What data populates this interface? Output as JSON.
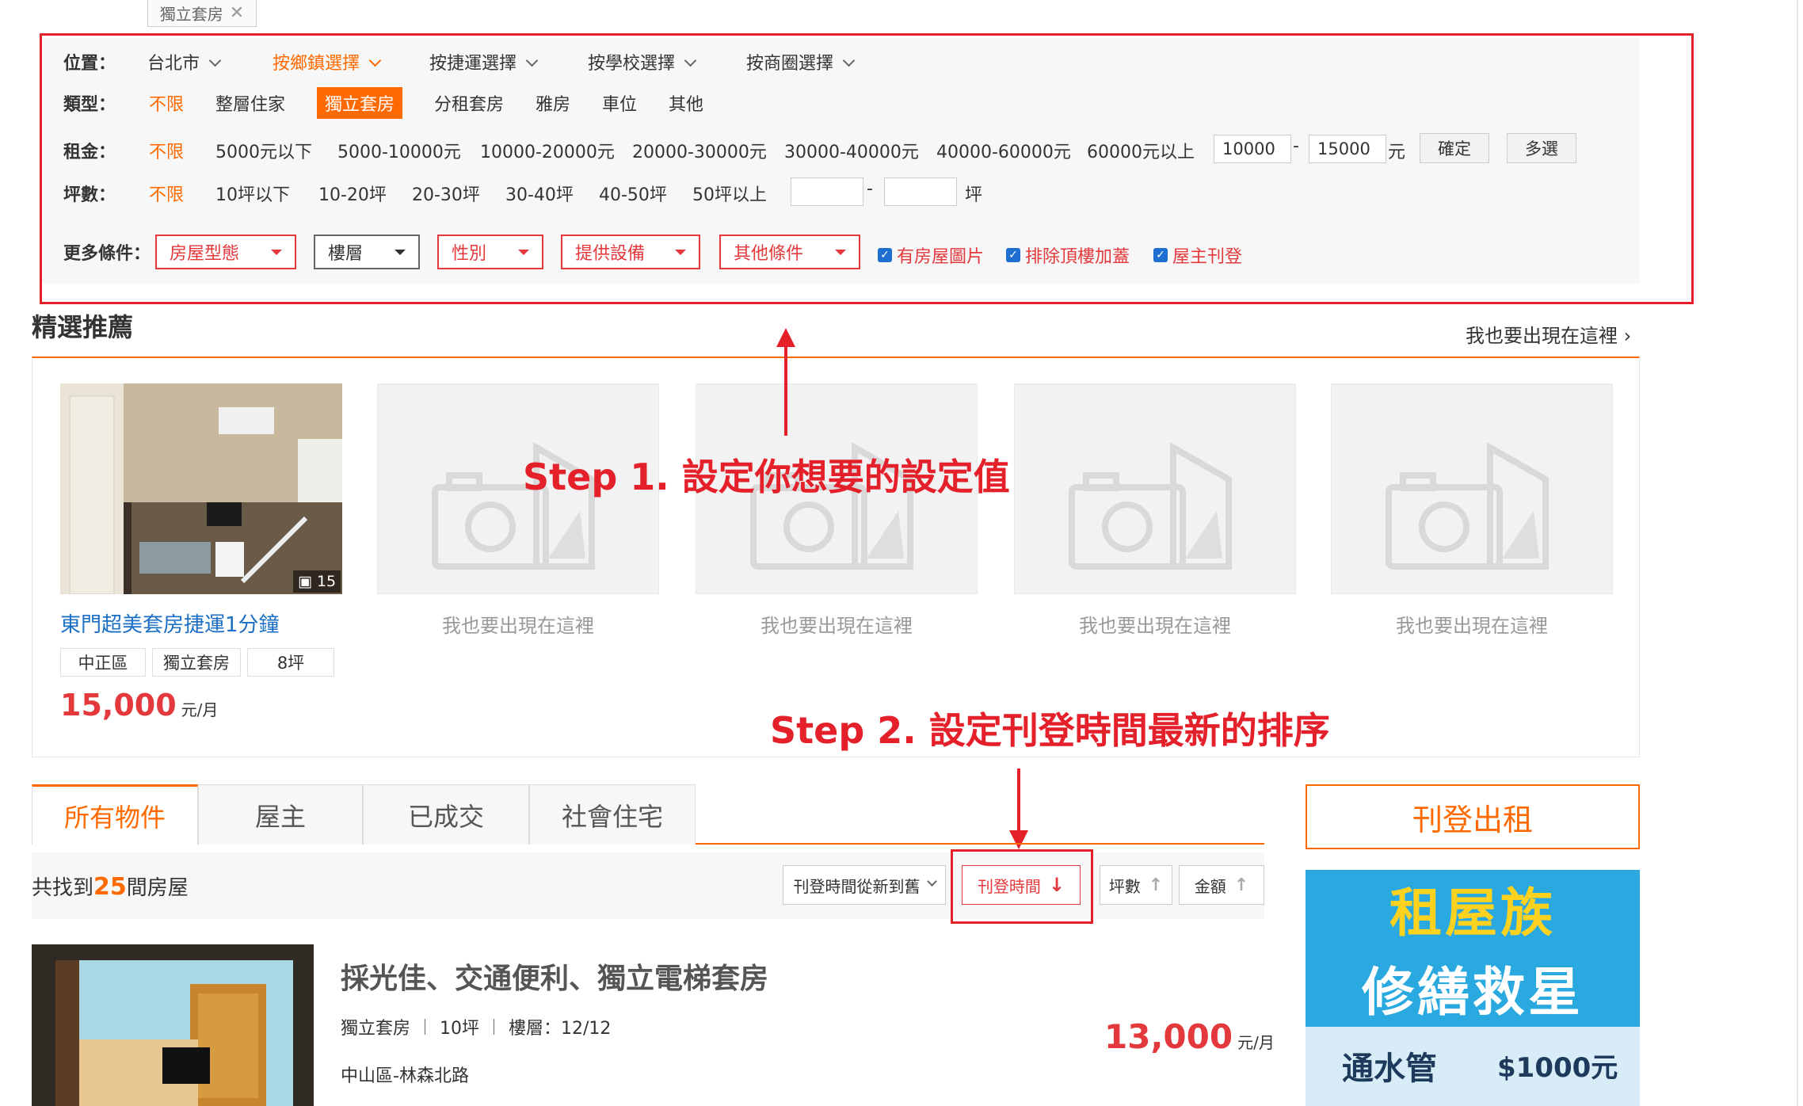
{
  "top_tag": {
    "label": "獨立套房"
  },
  "filters": {
    "location": {
      "label": "位置：",
      "items": [
        "台北市",
        "按鄉鎮選擇",
        "按捷運選擇",
        "按學校選擇",
        "按商圈選擇"
      ]
    },
    "type": {
      "label": "類型：",
      "items": [
        "不限",
        "整層住家",
        "獨立套房",
        "分租套房",
        "雅房",
        "車位",
        "其他"
      ]
    },
    "rent": {
      "label": "租金：",
      "items": [
        "不限",
        "5000元以下",
        "5000-10000元",
        "10000-20000元",
        "20000-30000元",
        "30000-40000元",
        "40000-60000元",
        "60000元以上"
      ],
      "min": "10000",
      "dash": "-",
      "max": "15000",
      "unit": "元",
      "confirm": "確定",
      "multi": "多選"
    },
    "size": {
      "label": "坪數：",
      "items": [
        "不限",
        "10坪以下",
        "10-20坪",
        "20-30坪",
        "30-40坪",
        "40-50坪",
        "50坪以上"
      ],
      "dash": "-",
      "unit": "坪"
    },
    "more": {
      "label": "更多條件：",
      "dropdowns": [
        "房屋型態",
        "樓層",
        "性別",
        "提供設備",
        "其他條件"
      ],
      "checks": [
        "有房屋圖片",
        "排除頂樓加蓋",
        "屋主刊登"
      ]
    }
  },
  "featured": {
    "title": "精選推薦",
    "promo_link": "我也要出現在這裡",
    "card": {
      "title": "東門超美套房捷運1分鐘",
      "photo_count": "15",
      "tags": [
        "中正區",
        "獨立套房",
        "8坪"
      ],
      "price": "15,000",
      "price_unit": "元/月"
    },
    "placeholder_label": "我也要出現在這裡"
  },
  "annotations": {
    "step1": "Step 1. 設定你想要的設定值",
    "step2": "Step 2. 設定刊登時間最新的排序"
  },
  "tabs": [
    "所有物件",
    "屋主",
    "已成交",
    "社會住宅"
  ],
  "results": {
    "prefix": "共找到",
    "count": "25",
    "suffix": "間房屋"
  },
  "sort": {
    "select": "刊登時間從新到舊",
    "post_time": "刊登時間",
    "size": "坪數",
    "price": "金額"
  },
  "listing": {
    "title": "採光佳、交通便利、獨立電梯套房",
    "type": "獨立套房",
    "size": "10坪",
    "floor": "樓層：12/12",
    "address": "中山區-林森北路",
    "price": "13,000",
    "price_unit": "元/月"
  },
  "sidebar": {
    "cta": "刊登出租",
    "ad_line1": "租屋族",
    "ad_line2": "修繕救星",
    "ad_service": "通水管",
    "ad_price": "$1000元"
  },
  "colors": {
    "accent": "#ff6a00",
    "annotation": "#e4202a",
    "checkbox": "#1f6fd1"
  }
}
